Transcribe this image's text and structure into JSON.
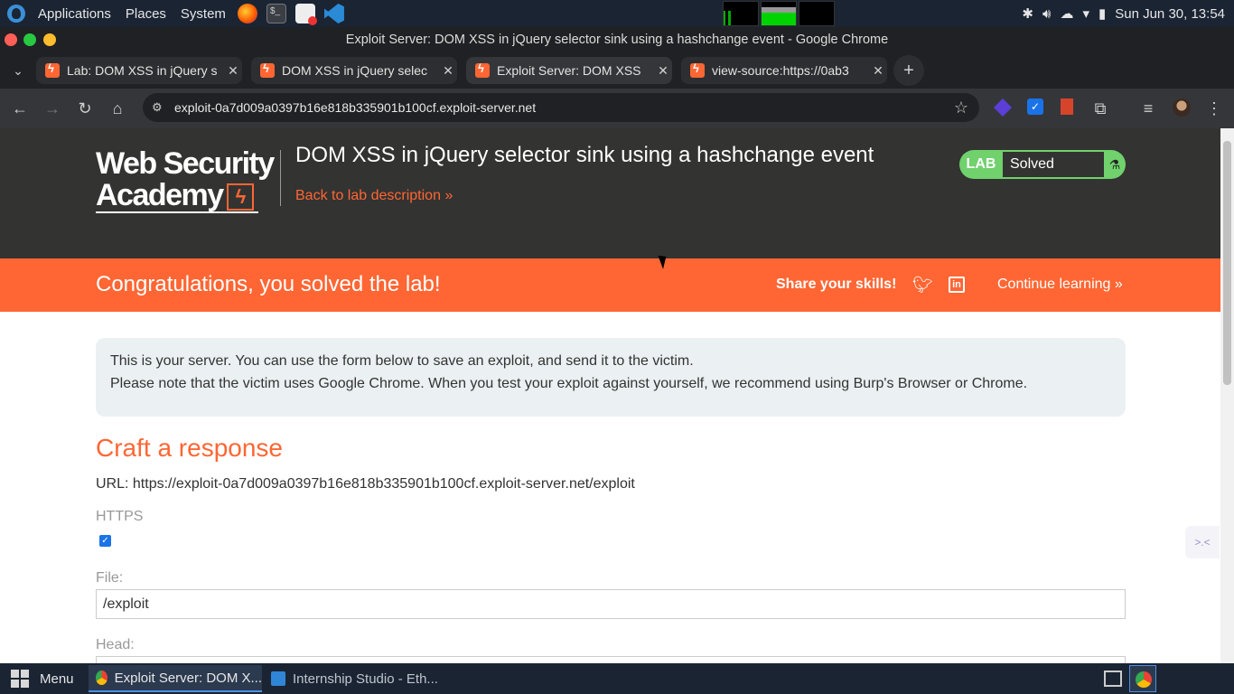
{
  "system_panel": {
    "menus": [
      "Applications",
      "Places",
      "System"
    ],
    "clock": "Sun Jun 30, 13:54"
  },
  "window": {
    "title": "Exploit Server: DOM XSS in jQuery selector sink using a hashchange event - Google Chrome"
  },
  "tabs": [
    {
      "label": "Lab: DOM XSS in jQuery s",
      "active": false
    },
    {
      "label": "DOM XSS in jQuery selec",
      "active": false
    },
    {
      "label": "Exploit Server: DOM XSS",
      "active": true
    },
    {
      "label": "view-source:https://0ab3",
      "active": false
    }
  ],
  "omnibox": {
    "url": "exploit-0a7d009a0397b16e818b335901b100cf.exploit-server.net"
  },
  "lab_header": {
    "logo_line1": "Web Security",
    "logo_line2": "Academy",
    "title": "DOM XSS in jQuery selector sink using a hashchange event",
    "back_link": "Back to lab description",
    "badge_label": "LAB",
    "badge_status": "Solved"
  },
  "congrats": {
    "message": "Congratulations, you solved the lab!",
    "share": "Share your skills!",
    "continue": "Continue learning"
  },
  "info": {
    "line1": "This is your server. You can use the form below to save an exploit, and send it to the victim.",
    "line2": "Please note that the victim uses Google Chrome. When you test your exploit against yourself, we recommend using Burp's Browser or Chrome."
  },
  "form": {
    "heading": "Craft a response",
    "url_line": "URL: https://exploit-0a7d009a0397b16e818b335901b100cf.exploit-server.net/exploit",
    "https_label": "HTTPS",
    "https_checked": true,
    "file_label": "File:",
    "file_value": "/exploit",
    "head_label": "Head:"
  },
  "taskbar": {
    "menu_label": "Menu",
    "tasks": [
      "Exploit Server: DOM X...",
      "Internship Studio - Eth..."
    ]
  },
  "colors": {
    "accent": "#ff6633",
    "lab_badge": "#70d16d",
    "header_bg": "#333332"
  }
}
